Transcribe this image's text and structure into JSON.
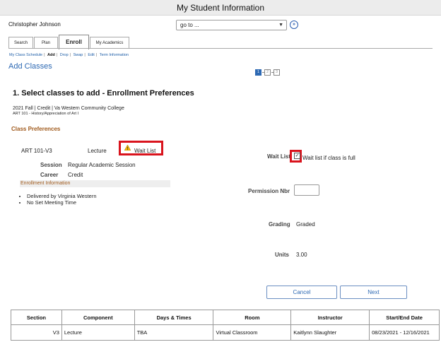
{
  "header": {
    "title": "My Student Information"
  },
  "user": {
    "name": "Christopher Johnson"
  },
  "goto": {
    "value": "go to ...",
    "go_label": "»"
  },
  "tabs": [
    "Search",
    "Plan",
    "Enroll",
    "My Academics"
  ],
  "active_tab": "Enroll",
  "subnav": {
    "items": [
      "My Class Schedule",
      "Add",
      "Drop",
      "Swap",
      "Edit",
      "Term Information"
    ],
    "current": "Add"
  },
  "page": {
    "title": "Add Classes"
  },
  "steps": [
    "1",
    "2",
    "3"
  ],
  "section": {
    "title": "1.  Select classes to add - Enrollment Preferences",
    "term": "2021 Fall | Credit | Va Western Community College",
    "course": "ART  101 - History/Appreciation of Art I"
  },
  "preferences": {
    "heading": "Class Preferences",
    "class_code": "ART  101-V3",
    "component": "Lecture",
    "status": "Wait List",
    "session_label": "Session",
    "session_value": "Regular Academic Session",
    "career_label": "Career",
    "career_value": "Credit",
    "enrollment_info_label": "Enrollment Information",
    "notes": [
      "Delivered by Virginia Western",
      "No Set Meeting Time"
    ],
    "wait_list_label": "Wait List",
    "wait_list_checked": true,
    "wait_list_text": "Wait list if class is full",
    "permission_label": "Permission Nbr",
    "permission_value": "",
    "grading_label": "Grading",
    "grading_value": "Graded",
    "units_label": "Units",
    "units_value": "3.00"
  },
  "buttons": {
    "cancel": "Cancel",
    "next": "Next"
  },
  "table": {
    "columns": [
      "Section",
      "Component",
      "Days & Times",
      "Room",
      "Instructor",
      "Start/End Date"
    ],
    "rows": [
      [
        "V3",
        "Lecture",
        "TBA",
        "Virtual Classroom",
        "Kaitlynn Slaughter",
        "08/23/2021 - 12/16/2021"
      ]
    ]
  },
  "colors": {
    "accent": "#2d69b3",
    "highlight": "#d9141d",
    "section_heading": "#a05a1c"
  }
}
